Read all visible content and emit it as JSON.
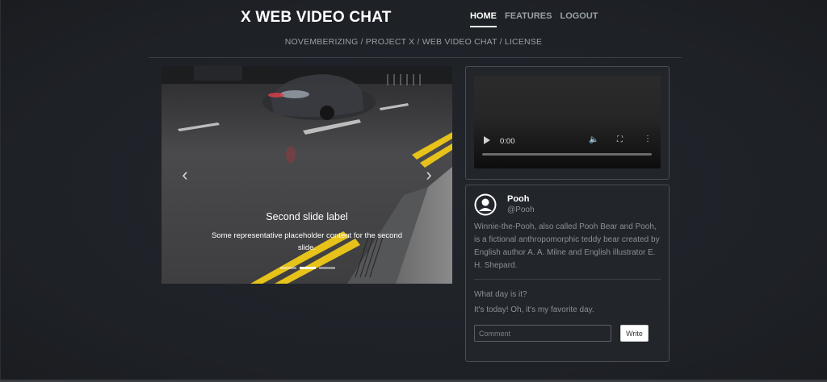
{
  "header": {
    "title": "X WEB VIDEO CHAT",
    "nav": [
      {
        "label": "HOME",
        "active": true
      },
      {
        "label": "FEATURES",
        "active": false
      },
      {
        "label": "LOGOUT",
        "active": false
      }
    ],
    "breadcrumb": "NOVEMBERIZING / PROJECT X / WEB VIDEO CHAT / LICENSE"
  },
  "carousel": {
    "prev_icon": "chevron-left-icon",
    "next_icon": "chevron-right-icon",
    "caption_title": "Second slide label",
    "caption_text": "Some representative placeholder content for the second slide.",
    "slide_count": 3,
    "active_slide": 2
  },
  "video": {
    "time": "0:00",
    "icons": [
      "play-icon",
      "volume-icon",
      "fullscreen-icon",
      "more-icon"
    ]
  },
  "profile": {
    "name": "Pooh",
    "handle": "@Pooh",
    "bio": "Winnie-the-Pooh, also called Pooh Bear and Pooh, is a fictional anthropomorphic teddy bear created by English author A. A. Milne and English illustrator E. H. Shepard.",
    "comments": [
      "What day is it?",
      "It's today! Oh, it's my favorite day."
    ],
    "comment_placeholder": "Comment",
    "write_label": "Write"
  },
  "colors": {
    "background": "#1f2227",
    "card_border": "#4a4e54",
    "muted_text": "#8a9097",
    "road_marking_yellow": "#e6c21a"
  }
}
